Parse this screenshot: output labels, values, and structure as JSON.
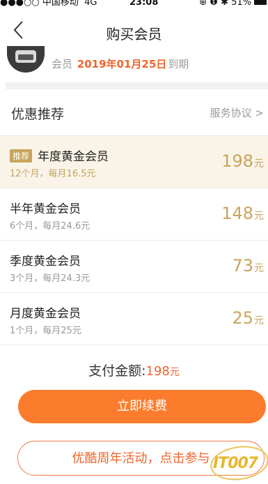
{
  "status_bar": {
    "carrier": "●●●○○ 中国移动",
    "network": "4G",
    "time": "23:08",
    "right_icons": "⊕ ❶ ✱ 51%"
  },
  "nav": {
    "back_icon": "chevron-left-icon",
    "title": "购买会员"
  },
  "member": {
    "label": "会员",
    "expiry_date": "2019年01月25日",
    "expiry_suffix": "到期"
  },
  "section": {
    "title": "优惠推荐",
    "agreement_label": "服务协议",
    "agreement_arrow": ">"
  },
  "plans": [
    {
      "badge": "推荐",
      "name": "年度黄金会员",
      "sub": "12个月，每月16.5元",
      "price": "198",
      "unit": "元",
      "selected": true
    },
    {
      "badge": "",
      "name": "半年黄金会员",
      "sub": "6个月，每月24.6元",
      "price": "148",
      "unit": "元",
      "selected": false
    },
    {
      "badge": "",
      "name": "季度黄金会员",
      "sub": "3个月，每月24.3元",
      "price": "73",
      "unit": "元",
      "selected": false
    },
    {
      "badge": "",
      "name": "月度黄金会员",
      "sub": "1个月，每月25元",
      "price": "25",
      "unit": "元",
      "selected": false
    }
  ],
  "payment": {
    "label": "支付金额:",
    "amount": "198",
    "unit": "元"
  },
  "buttons": {
    "renew": "立即续费",
    "promo": "优酷周年活动，点击参与"
  },
  "watermark": {
    "text": "IT007"
  },
  "colors": {
    "accent_orange": "#fb7c2c",
    "gold": "#c9a45b",
    "highlight_bg": "#faf4e8"
  }
}
